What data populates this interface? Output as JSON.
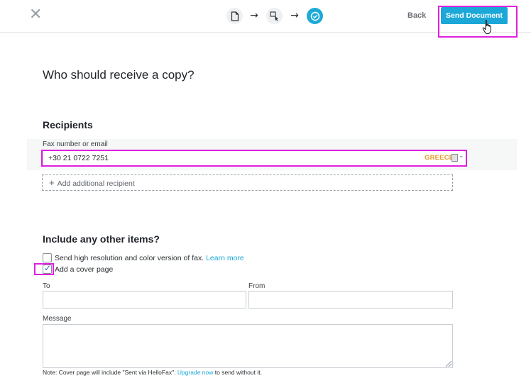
{
  "topbar": {
    "close_glyph": "✕",
    "steps": [
      {
        "icon": "document-icon",
        "state": "done"
      },
      {
        "icon": "select-cursor-icon",
        "state": "done"
      },
      {
        "icon": "check-circle-icon",
        "state": "active"
      }
    ],
    "arrow_glyph": "→",
    "back_label": "Back",
    "send_label": "Send Document"
  },
  "main": {
    "heading": "Who should receive a copy?",
    "recipients": {
      "title": "Recipients",
      "fax_label": "Fax number or email",
      "fax_value": "+30 21 0722 7251",
      "country": "GREECE",
      "add_label": "Add additional recipient",
      "add_glyph": "+"
    },
    "other": {
      "title": "Include any other items?",
      "option_hires": {
        "label": "Send high resolution and color version of fax.",
        "link": "Learn more",
        "checked": false
      },
      "option_cover": {
        "label": "Add a cover page",
        "checked": true
      },
      "to_label": "To",
      "from_label": "From",
      "message_label": "Message",
      "note_prefix": "Note: Cover page will include \"Sent via HelloFax\".",
      "note_link": "Upgrade now",
      "note_suffix": "to send without it."
    }
  },
  "colors": {
    "accent": "#1ba8d8",
    "highlight": "#e020e0",
    "country": "#e69b2d"
  }
}
